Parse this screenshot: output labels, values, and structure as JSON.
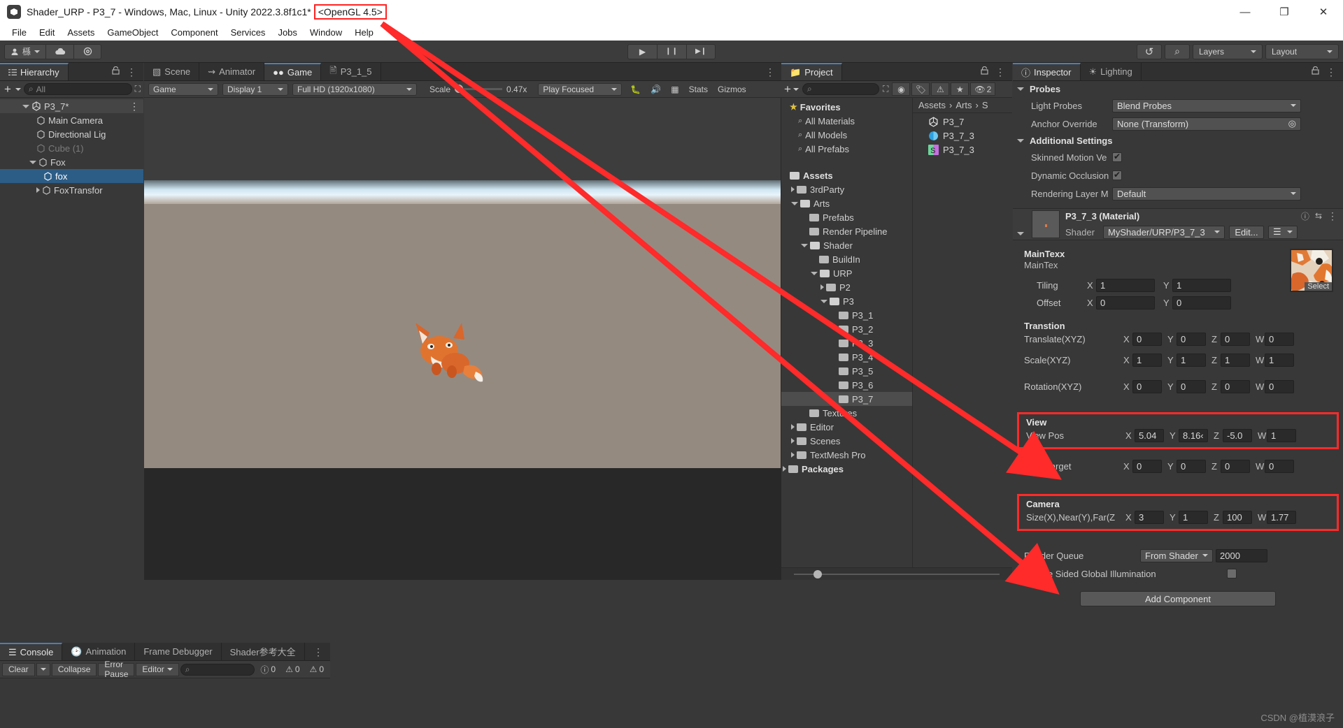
{
  "window": {
    "title": "Shader_URP - P3_7 - Windows, Mac, Linux - Unity 2022.3.8f1c1*",
    "graphics_badge": "<OpenGL 4.5>",
    "minimize": "—",
    "maximize": "❐",
    "close": "✕"
  },
  "menu": [
    "File",
    "Edit",
    "Assets",
    "GameObject",
    "Component",
    "Services",
    "Jobs",
    "Window",
    "Help"
  ],
  "toolbar": {
    "account_icon": "account-icon",
    "cloud_icon": "cloud-icon",
    "settings_icon": "gear-icon",
    "collab_label": "槂",
    "play_icon": "▶",
    "pause_icon": "❙❙",
    "step_icon": "▶❙",
    "history_icon": "↺",
    "search_icon": "⌕",
    "layers_label": "Layers",
    "layout_label": "Layout"
  },
  "hierarchy": {
    "tab": "Hierarchy",
    "lock_icon": "lock-icon",
    "menu_icon": "kebab-menu-icon",
    "add_label": "+",
    "search_placeholder": "All",
    "items": [
      {
        "label": "P3_7*",
        "depth": 0,
        "arrow": "open",
        "icon": "unity-scene-icon",
        "state": "scene-root"
      },
      {
        "label": "Main Camera",
        "depth": 1,
        "arrow": "none",
        "icon": "gameobject-icon",
        "state": "normal"
      },
      {
        "label": "Directional Lig",
        "depth": 1,
        "arrow": "none",
        "icon": "gameobject-icon",
        "state": "normal"
      },
      {
        "label": "Cube (1)",
        "depth": 1,
        "arrow": "none",
        "icon": "gameobject-icon",
        "state": "dim"
      },
      {
        "label": "Fox",
        "depth": 1,
        "arrow": "open",
        "icon": "gameobject-icon",
        "state": "normal"
      },
      {
        "label": "fox",
        "depth": 2,
        "arrow": "none",
        "icon": "gameobject-icon",
        "state": "selected"
      },
      {
        "label": "FoxTransfor",
        "depth": 2,
        "arrow": "closed",
        "icon": "gameobject-icon",
        "state": "normal"
      }
    ]
  },
  "sceneview": {
    "tabs": [
      {
        "label": "Scene",
        "icon": "grid-icon",
        "active": false
      },
      {
        "label": "Animator",
        "icon": "animator-icon",
        "active": false
      },
      {
        "label": "Game",
        "icon": "game-icon",
        "active": true
      },
      {
        "label": "P3_1_5",
        "icon": "script-icon",
        "active": false
      }
    ],
    "menu_icon": "kebab-menu-icon",
    "toolbar": {
      "display_mode": "Game",
      "display": "Display 1",
      "resolution": "Full HD (1920x1080)",
      "scale_label": "Scale",
      "scale_value": "0.47x",
      "play_focused": "Play Focused",
      "mute_icon": "mute-audio-icon",
      "bug_icon": "debug-icon",
      "grid_icon": "grid-toggle-icon",
      "stats": "Stats",
      "gizmos": "Gizmos"
    }
  },
  "project": {
    "tab": "Project",
    "lock_icon": "lock-icon",
    "menu_icon": "kebab-menu-icon",
    "add_label": "+",
    "search_placeholder": "",
    "toolbar_icons": [
      "save-filter-icon",
      "label-icon",
      "warning-icon",
      "star-icon",
      "hidden-icon"
    ],
    "hidden_count": "2",
    "tree": [
      {
        "label": "Favorites",
        "type": "favorites",
        "depth": 0
      },
      {
        "label": "All Materials",
        "type": "search",
        "depth": 1
      },
      {
        "label": "All Models",
        "type": "search",
        "depth": 1
      },
      {
        "label": "All Prefabs",
        "type": "search",
        "depth": 1
      },
      {
        "label": "",
        "type": "spacer",
        "depth": 0
      },
      {
        "label": "Assets",
        "type": "folder-open",
        "depth": 0
      },
      {
        "label": "3rdParty",
        "type": "folder",
        "depth": 1,
        "arrow": true
      },
      {
        "label": "Arts",
        "type": "folder-open",
        "depth": 1,
        "arrow": true
      },
      {
        "label": "Prefabs",
        "type": "folder",
        "depth": 2
      },
      {
        "label": "Render Pipeline",
        "type": "folder",
        "depth": 2
      },
      {
        "label": "Shader",
        "type": "folder-open",
        "depth": 2,
        "arrow": true
      },
      {
        "label": "BuildIn",
        "type": "folder",
        "depth": 3
      },
      {
        "label": "URP",
        "type": "folder-open",
        "depth": 3,
        "arrow": true
      },
      {
        "label": "P2",
        "type": "folder",
        "depth": 4,
        "arrow": true
      },
      {
        "label": "P3",
        "type": "folder-open",
        "depth": 4,
        "arrow": true
      },
      {
        "label": "P3_1",
        "type": "folder",
        "depth": 5
      },
      {
        "label": "P3_2",
        "type": "folder",
        "depth": 5
      },
      {
        "label": "P3_3",
        "type": "folder",
        "depth": 5
      },
      {
        "label": "P3_4",
        "type": "folder",
        "depth": 5
      },
      {
        "label": "P3_5",
        "type": "folder",
        "depth": 5
      },
      {
        "label": "P3_6",
        "type": "folder",
        "depth": 5
      },
      {
        "label": "P3_7",
        "type": "folder",
        "depth": 5,
        "selected": true
      },
      {
        "label": "Textures",
        "type": "folder",
        "depth": 2
      },
      {
        "label": "Editor",
        "type": "folder",
        "depth": 1,
        "arrow": true
      },
      {
        "label": "Scenes",
        "type": "folder",
        "depth": 1,
        "arrow": true
      },
      {
        "label": "TextMesh Pro",
        "type": "folder",
        "depth": 1,
        "arrow": true
      },
      {
        "label": "Packages",
        "type": "packages",
        "depth": 0,
        "arrow": true
      }
    ],
    "breadcrumb": [
      "Assets",
      "Arts",
      "S"
    ],
    "assets": [
      {
        "label": "P3_7",
        "icon": "unity-scene-icon"
      },
      {
        "label": "P3_7_3",
        "icon": "material-icon"
      },
      {
        "label": "P3_7_3",
        "icon": "shader-icon"
      }
    ]
  },
  "inspector": {
    "tabs": [
      {
        "label": "Inspector",
        "icon": "info-icon",
        "active": true
      },
      {
        "label": "Lighting",
        "icon": "light-icon",
        "active": false
      }
    ],
    "lock_icon": "lock-icon",
    "menu_icon": "kebab-menu-icon",
    "probes": {
      "title": "Probes",
      "light_probes_label": "Light Probes",
      "light_probes_value": "Blend Probes",
      "anchor_label": "Anchor Override",
      "anchor_value": "None (Transform)"
    },
    "additional": {
      "title": "Additional Settings",
      "skinned_label": "Skinned Motion Ve",
      "skinned_checked": true,
      "dynamic_label": "Dynamic Occlusion",
      "dynamic_checked": true,
      "rendering_layer_label": "Rendering Layer M",
      "rendering_layer_value": "Default"
    },
    "material": {
      "title": "P3_7_3 (Material)",
      "shader_label": "Shader",
      "shader_value": "MyShader/URP/P3_7_3",
      "edit_label": "Edit...",
      "preset_icon": "preset-icon",
      "help_icon": "help-icon",
      "settings_icon": "gear-icon",
      "menu_icon": "kebab-menu-icon"
    },
    "maintex": {
      "title": "MainTexx",
      "subtitle": "MainTex",
      "select_label": "Select",
      "tiling_label": "Tiling",
      "tiling": {
        "x": "1",
        "y": "1"
      },
      "offset_label": "Offset",
      "offset": {
        "x": "0",
        "y": "0"
      }
    },
    "transition": {
      "title": "Transtion",
      "translate_label": "Translate(XYZ)",
      "translate": {
        "x": "0",
        "y": "0",
        "z": "0",
        "w": "0"
      },
      "scale_label": "Scale(XYZ)",
      "scale": {
        "x": "1",
        "y": "1",
        "z": "1",
        "w": "1"
      },
      "rotation_label": "Rotation(XYZ)",
      "rotation": {
        "x": "0",
        "y": "0",
        "z": "0",
        "w": "0"
      }
    },
    "view": {
      "title": "View",
      "pos_label": "View Pos",
      "pos": {
        "x": "5.04",
        "y": "8.16‹",
        "z": "-5.0",
        "w": "1"
      },
      "target_label": "View Target",
      "target": {
        "x": "0",
        "y": "0",
        "z": "0",
        "w": "0"
      }
    },
    "camera": {
      "title": "Camera",
      "params_label": "Size(X),Near(Y),Far(Z",
      "params": {
        "x": "3",
        "y": "1",
        "z": "100",
        "w": "1.77"
      }
    },
    "render_queue": {
      "label": "Render Queue",
      "mode": "From Shader",
      "value": "2000"
    },
    "double_sided_label": "Double Sided Global Illumination",
    "double_sided_checked": false,
    "add_component": "Add Component",
    "axis_x": "X",
    "axis_y": "Y",
    "axis_z": "Z",
    "axis_w": "W"
  },
  "console": {
    "tabs": [
      {
        "label": "Console",
        "icon": "console-icon",
        "active": true
      },
      {
        "label": "Animation",
        "icon": "clock-icon",
        "active": false
      },
      {
        "label": "Frame Debugger",
        "icon": "",
        "active": false
      },
      {
        "label": "Shader参考大全",
        "icon": "",
        "active": false
      }
    ],
    "menu_icon": "kebab-menu-icon",
    "clear_label": "Clear",
    "collapse_label": "Collapse",
    "error_pause_label": "Error Pause",
    "editor_label": "Editor",
    "search_placeholder": "",
    "counts": {
      "log": "0",
      "warning": "0",
      "error": "0"
    }
  },
  "watermark": "CSDN @植漠浪子",
  "colors": {
    "accent_red": "#ff2a2a",
    "selection_blue": "#2c5d87",
    "panel_bg": "#383838",
    "tab_bg": "#303030"
  }
}
